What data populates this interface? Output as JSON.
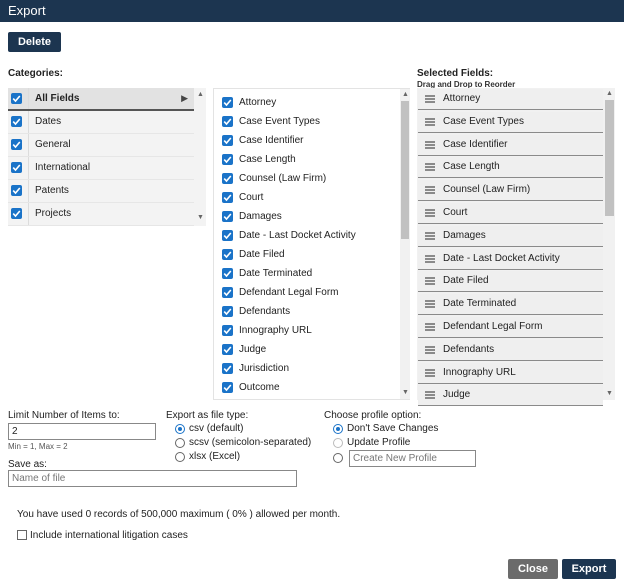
{
  "window": {
    "title": "Export"
  },
  "toolbar": {
    "delete_label": "Delete"
  },
  "categories": {
    "label": "Categories:",
    "items": [
      {
        "label": "All Fields",
        "checked": true,
        "active": true
      },
      {
        "label": "Dates",
        "checked": true
      },
      {
        "label": "General",
        "checked": true
      },
      {
        "label": "International",
        "checked": true
      },
      {
        "label": "Patents",
        "checked": true
      },
      {
        "label": "Projects",
        "checked": true
      }
    ]
  },
  "fields": {
    "items": [
      "Attorney",
      "Case Event Types",
      "Case Identifier",
      "Case Length",
      "Counsel (Law Firm)",
      "Court",
      "Damages",
      "Date - Last Docket Activity",
      "Date Filed",
      "Date Terminated",
      "Defendant Legal Form",
      "Defendants",
      "Innography URL",
      "Judge",
      "Jurisdiction",
      "Outcome"
    ]
  },
  "selected_fields": {
    "label": "Selected Fields:",
    "hint": "Drag and Drop to Reorder",
    "items": [
      "Attorney",
      "Case Event Types",
      "Case Identifier",
      "Case Length",
      "Counsel (Law Firm)",
      "Court",
      "Damages",
      "Date - Last Docket Activity",
      "Date Filed",
      "Date Terminated",
      "Defendant Legal Form",
      "Defendants",
      "Innography URL",
      "Judge"
    ]
  },
  "limit": {
    "label": "Limit Number of Items to:",
    "value": "2",
    "hint": "Min = 1, Max = 2"
  },
  "save_as": {
    "label": "Save as:",
    "placeholder": "Name of file"
  },
  "file_type": {
    "label": "Export as file type:",
    "options": [
      {
        "label": "csv (default)",
        "selected": true
      },
      {
        "label": "scsv (semicolon-separated)",
        "selected": false
      },
      {
        "label": "xlsx (Excel)",
        "selected": false
      }
    ]
  },
  "profile": {
    "label": "Choose profile option:",
    "options": [
      {
        "label": "Don't Save Changes",
        "selected": true,
        "disabled": false
      },
      {
        "label": "Update Profile",
        "selected": false,
        "disabled": true
      }
    ],
    "new_placeholder": "Create New Profile"
  },
  "usage_text": "You have used 0 records of 500,000 maximum ( 0% ) allowed per month.",
  "international_option": {
    "label": "Include international litigation cases",
    "checked": false
  },
  "footer": {
    "close_label": "Close",
    "export_label": "Export"
  },
  "colors": {
    "header": "#1c3550",
    "checkbox": "#1a73c8",
    "close_button": "#6b6b6b"
  }
}
